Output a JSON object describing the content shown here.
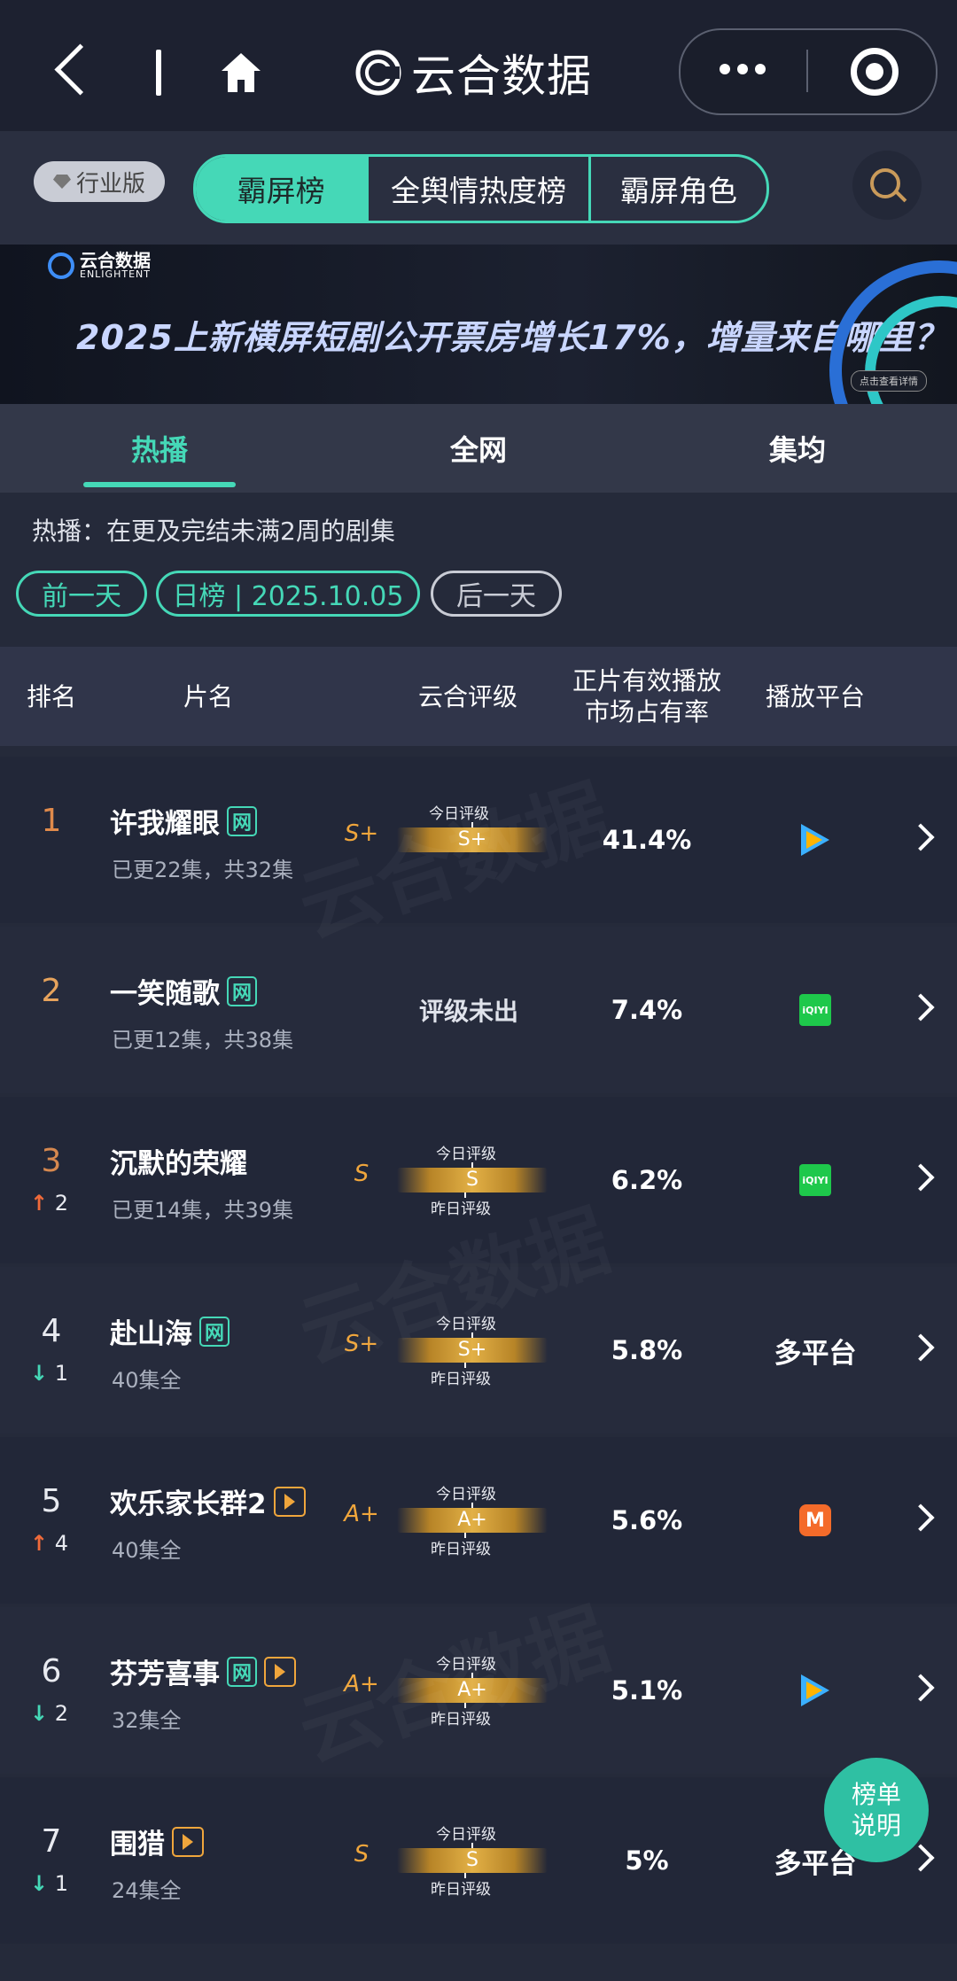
{
  "brand": {
    "name": "云合数据"
  },
  "header": {
    "edition_label": "行业版",
    "tabs": [
      {
        "label": "霸屏榜",
        "active": true
      },
      {
        "label": "全舆情热度榜",
        "active": false
      },
      {
        "label": "霸屏角色",
        "active": false
      }
    ]
  },
  "banner": {
    "logo_text": "云合数据",
    "logo_sub": "ENLIGHTENT",
    "title": "2025上新横屏短剧公开票房增长17%，增量来自哪里？",
    "button": "点击查看详情"
  },
  "subtabs": [
    {
      "label": "热播",
      "active": true
    },
    {
      "label": "全网",
      "active": false
    },
    {
      "label": "集均",
      "active": false
    }
  ],
  "description": "热播：在更及完结未满2周的剧集",
  "date_nav": {
    "prev": "前一天",
    "current": "日榜 | 2025.10.05",
    "next": "后一天"
  },
  "table": {
    "columns": [
      "排名",
      "片名",
      "云合评级",
      "正片有效播放\n市场占有率",
      "播放平台"
    ],
    "labels": {
      "today": "今日评级",
      "yesterday": "昨日评级"
    },
    "rows": [
      {
        "rank": "1",
        "change_dir": "",
        "change": "",
        "title": "许我耀眼",
        "badges": [
          "网"
        ],
        "episodes": "已更22集，共32集",
        "grade_letter": "S+",
        "grade_today": "S+",
        "show_yesterday": false,
        "share": "41.4%",
        "platform": "tencent-video-icon",
        "platform_text": ""
      },
      {
        "rank": "2",
        "change_dir": "",
        "change": "",
        "title": "一笑随歌",
        "badges": [
          "网"
        ],
        "episodes": "已更12集，共38集",
        "grade_letter": "",
        "grade_today": "",
        "no_grade_text": "评级未出",
        "show_yesterday": false,
        "share": "7.4%",
        "platform": "iqiyi-icon",
        "platform_text": ""
      },
      {
        "rank": "3",
        "change_dir": "up",
        "change": "2",
        "title": "沉默的荣耀",
        "badges": [],
        "episodes": "已更14集，共39集",
        "grade_letter": "S",
        "grade_today": "S",
        "show_yesterday": true,
        "share": "6.2%",
        "platform": "iqiyi-icon",
        "platform_text": ""
      },
      {
        "rank": "4",
        "change_dir": "down",
        "change": "1",
        "title": "赴山海",
        "badges": [
          "网"
        ],
        "episodes": "40集全",
        "grade_letter": "S+",
        "grade_today": "S+",
        "show_yesterday": true,
        "share": "5.8%",
        "platform": "",
        "platform_text": "多平台"
      },
      {
        "rank": "5",
        "change_dir": "up",
        "change": "4",
        "title": "欢乐家长群2",
        "badges": [
          "play"
        ],
        "episodes": "40集全",
        "grade_letter": "A+",
        "grade_today": "A+",
        "show_yesterday": true,
        "share": "5.6%",
        "platform": "mango-tv-icon",
        "platform_text": ""
      },
      {
        "rank": "6",
        "change_dir": "down",
        "change": "2",
        "title": "芬芳喜事",
        "badges": [
          "网",
          "play"
        ],
        "episodes": "32集全",
        "grade_letter": "A+",
        "grade_today": "A+",
        "show_yesterday": true,
        "share": "5.1%",
        "platform": "tencent-video-icon",
        "platform_text": ""
      },
      {
        "rank": "7",
        "change_dir": "down",
        "change": "1",
        "title": "围猎",
        "badges": [
          "play"
        ],
        "episodes": "24集全",
        "grade_letter": "S",
        "grade_today": "S",
        "show_yesterday": true,
        "share": "5%",
        "platform": "",
        "platform_text": "多平台"
      }
    ]
  },
  "float_button": {
    "line1": "榜单",
    "line2": "说明"
  },
  "watermark": {
    "cn": "云合数据",
    "en": "ENLIGHTENT"
  },
  "colors": {
    "accent": "#45d8b7",
    "grade": "#f0a63c",
    "bg": "#252a3a"
  }
}
